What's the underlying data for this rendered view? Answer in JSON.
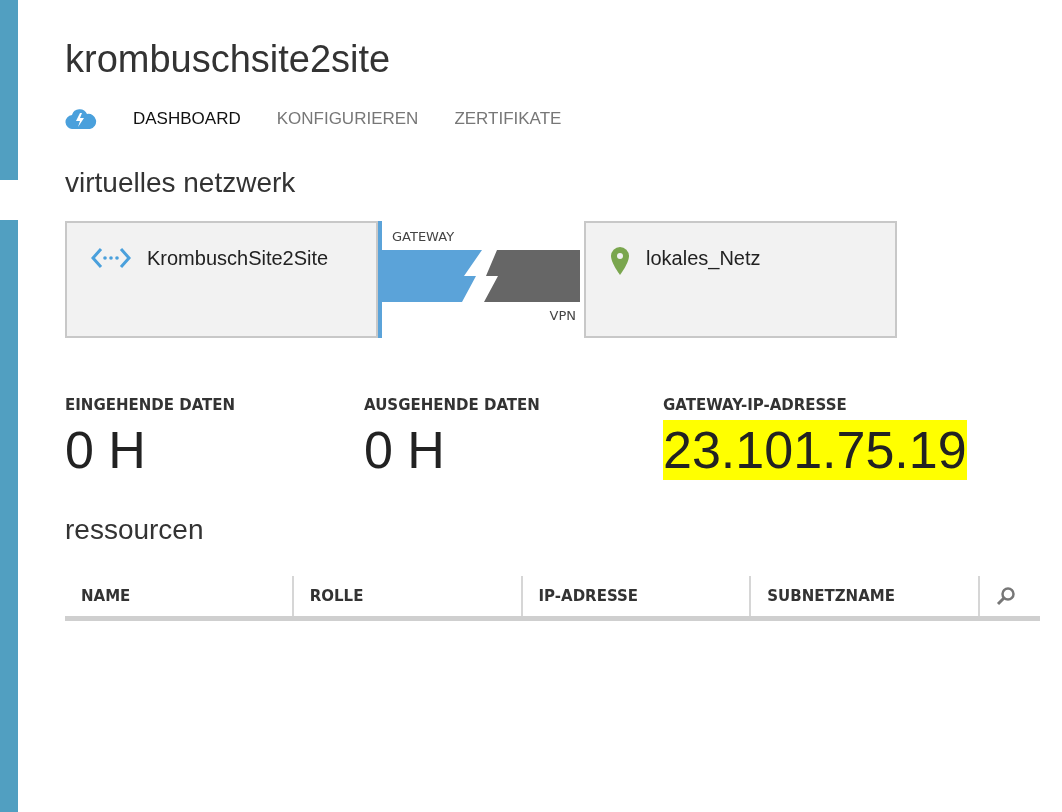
{
  "title": "krombuschsite2site",
  "tabs": [
    {
      "label": "DASHBOARD",
      "selected": true
    },
    {
      "label": "KONFIGURIEREN",
      "selected": false
    },
    {
      "label": "ZERTIFIKATE",
      "selected": false
    }
  ],
  "network": {
    "heading": "virtuelles netzwerk",
    "virtual_network": "KrombuschSite2Site",
    "gateway_label": "GATEWAY",
    "vpn_label": "VPN",
    "local_network": "lokales_Netz"
  },
  "stats": [
    {
      "label": "EINGEHENDE DATEN",
      "value": "0",
      "unit": "H",
      "highlighted": false
    },
    {
      "label": "AUSGEHENDE DATEN",
      "value": "0",
      "unit": "H",
      "highlighted": false
    },
    {
      "label": "GATEWAY-IP-ADRESSE",
      "value": "23.101.75.19",
      "highlighted": true
    }
  ],
  "resources": {
    "heading": "ressourcen",
    "columns": [
      "NAME",
      "ROLLE",
      "IP-ADRESSE",
      "SUBNETZNAME"
    ]
  }
}
